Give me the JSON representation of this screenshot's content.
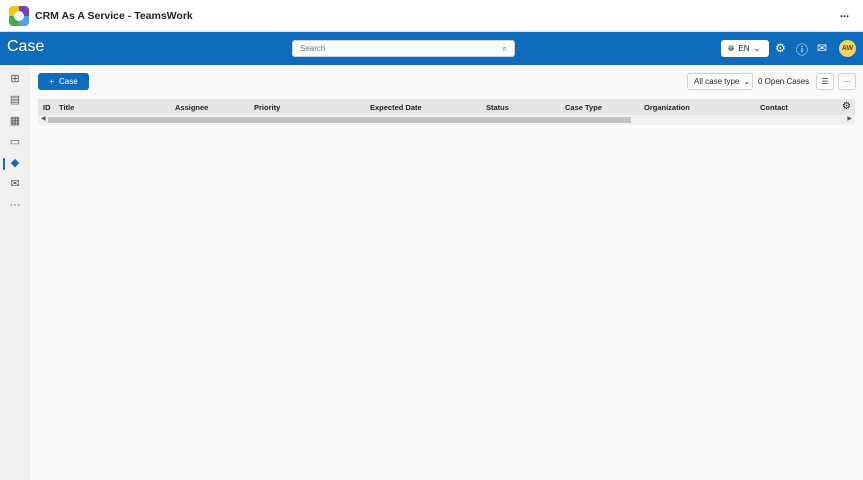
{
  "app": {
    "title": "CRM As A Service - TeamsWork",
    "more": "..."
  },
  "header": {
    "title": "Case",
    "search_placeholder": "Search",
    "language": "EN",
    "avatar_initials": "AW"
  },
  "sidebar": {
    "items": [
      "dashboard-icon",
      "contacts-icon",
      "organization-icon",
      "contact-card-icon",
      "case-ticket-icon",
      "mail-icon",
      "more-icon"
    ],
    "active": "case-ticket-icon",
    "more": "···"
  },
  "toolbar": {
    "new_case_label": "Case",
    "case_type_filter": "All case type",
    "open_cases": "0 Open Cases",
    "more": "···"
  },
  "table": {
    "columns": [
      "ID",
      "Title",
      "Assignee",
      "Priority",
      "Expected Date",
      "Status",
      "Case Type",
      "Organization",
      "Contact"
    ],
    "rows": []
  },
  "colors": {
    "accent": "#0f6cbd"
  }
}
